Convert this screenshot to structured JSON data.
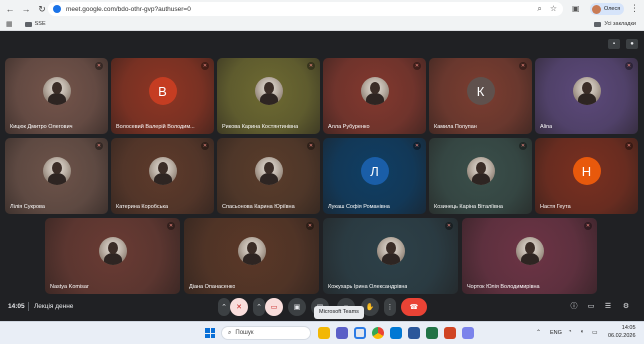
{
  "browser": {
    "url": "meet.google.com/bdo-othr-gvp?authuser=0",
    "profile_name": "Олеся",
    "bookmark_folder": "SSE",
    "bookmarks_right": "Усі закладки"
  },
  "meeting": {
    "time": "14:05",
    "name": "Лекція денне",
    "tooltip": "Microsoft Teams"
  },
  "participants": [
    {
      "name": "Кицюк Дмитро Олегович",
      "avatar": "photo",
      "bg": "#74544a",
      "initial": ""
    },
    {
      "name": "Волосевий Валерій Володим...",
      "avatar": "letter",
      "bg": "#8e3523",
      "initial": "В",
      "avatar_color": "#c53d22"
    },
    {
      "name": "Рикова Карина Костянтинівна",
      "avatar": "photo",
      "bg": "#6e6a31",
      "initial": ""
    },
    {
      "name": "Алла Рубуренко",
      "avatar": "photo",
      "bg": "#83382e",
      "initial": ""
    },
    {
      "name": "Камила Полупан",
      "avatar": "letter",
      "bg": "#7b3d30",
      "initial": "К",
      "avatar_color": "#5f514d"
    },
    {
      "name": "Alina",
      "avatar": "photo",
      "bg": "#5c497a",
      "initial": ""
    },
    {
      "name": "Лілія Сукрова",
      "avatar": "photo",
      "bg": "#6d5349",
      "initial": ""
    },
    {
      "name": "Катерина Коробська",
      "avatar": "photo",
      "bg": "#5e3a2a",
      "initial": ""
    },
    {
      "name": "Спасьонова Карина Юріївна",
      "avatar": "photo",
      "bg": "#5a3c2a",
      "initial": ""
    },
    {
      "name": "Лукаш Софія Романівна",
      "avatar": "letter",
      "bg": "#0f3e64",
      "initial": "Л",
      "avatar_color": "#1a5ea8"
    },
    {
      "name": "Козинець Каріна Віталіївна",
      "avatar": "photo",
      "bg": "#3a4f4a",
      "initial": ""
    },
    {
      "name": "Настя Геута",
      "avatar": "letter",
      "bg": "#7a2f1f",
      "initial": "Н",
      "avatar_color": "#e8590c"
    },
    {
      "name": "Nastya Komisar",
      "avatar": "photo",
      "bg": "#6a3b33",
      "initial": ""
    },
    {
      "name": "Діана Опанасенко",
      "avatar": "photo",
      "bg": "#5b3827",
      "initial": ""
    },
    {
      "name": "Кожухарь Ірина Олександрівна",
      "avatar": "photo",
      "bg": "#2d4149",
      "initial": ""
    },
    {
      "name": "Чорток Юлія Володимирівна",
      "avatar": "photo",
      "bg": "#6d3445",
      "initial": ""
    }
  ],
  "taskbar": {
    "search_label": "Пошук",
    "lang": "ENG",
    "clock_time": "14:05",
    "clock_date": "06.02.2026"
  }
}
